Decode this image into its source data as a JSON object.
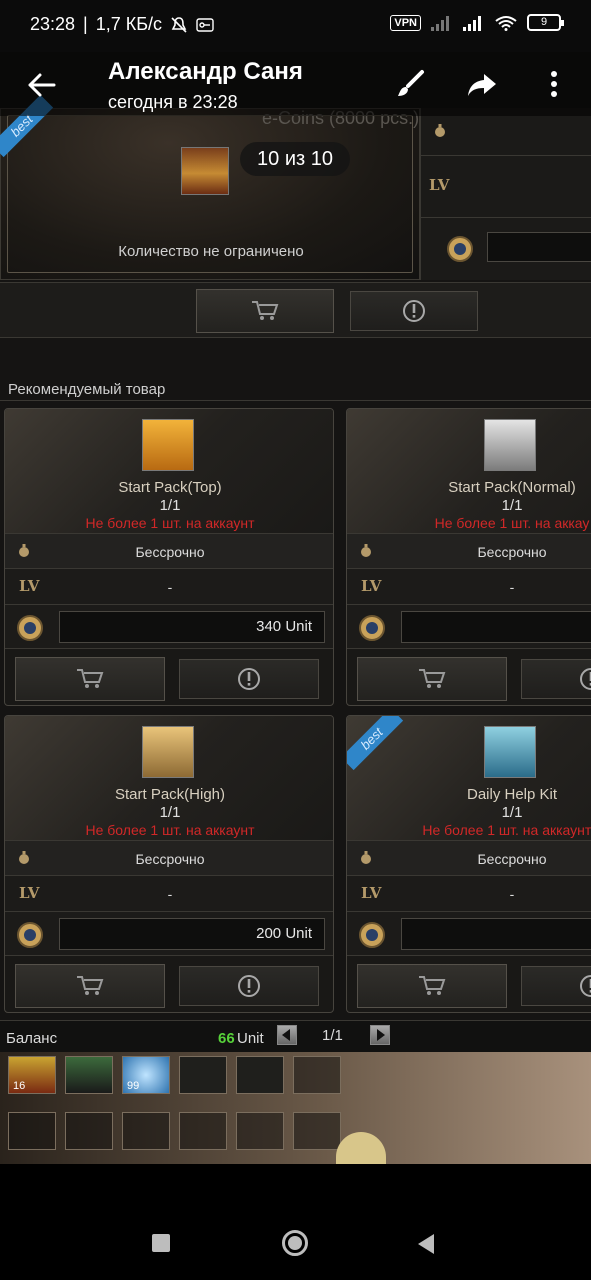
{
  "status_bar": {
    "time": "23:28",
    "speed": "1,7 КБ/с",
    "vpn": "VPN",
    "battery": "9"
  },
  "viewer": {
    "title": "Александр Саня",
    "subtitle": "сегодня в 23:28",
    "counter": "10 из 10"
  },
  "shop": {
    "ghost_title": "e-Coins (8000 pcs.)",
    "top_product": {
      "quantity_text": "Количество не ограничено",
      "ribbon": "best",
      "lv_label": "LV"
    },
    "section_title": "Рекомендуемый товар",
    "cards": [
      {
        "name": "Start Pack(Top)",
        "count": "1/1",
        "limit": "Не более 1 шт. на аккаунт",
        "duration": "Бессрочно",
        "lv_label": "LV",
        "level": "-",
        "price": "340 Unit",
        "ribbon": ""
      },
      {
        "name": "Start Pack(Normal)",
        "count": "1/1",
        "limit": "Не более 1 шт. на аккау",
        "duration": "Бессрочно",
        "lv_label": "LV",
        "level": "-",
        "price": "",
        "ribbon": ""
      },
      {
        "name": "Start Pack(High)",
        "count": "1/1",
        "limit": "Не более 1 шт. на аккаунт",
        "duration": "Бессрочно",
        "lv_label": "LV",
        "level": "-",
        "price": "200 Unit",
        "ribbon": ""
      },
      {
        "name": "Daily Help Kit",
        "count": "1/1",
        "limit": "Не более 1 шт. на аккаунт з",
        "duration": "Бессрочно",
        "lv_label": "LV",
        "level": "-",
        "price": "",
        "ribbon": "best"
      }
    ],
    "balance": {
      "label": "Баланс",
      "amount": "66",
      "unit": "Unit",
      "page": "1/1"
    },
    "inventory_counts": [
      "16",
      "99"
    ]
  },
  "colors": {
    "limit_red": "#d12828",
    "balance_green": "#57d13a",
    "ribbon_blue": "#2f86c9",
    "lv_gold": "#b49a6a"
  }
}
